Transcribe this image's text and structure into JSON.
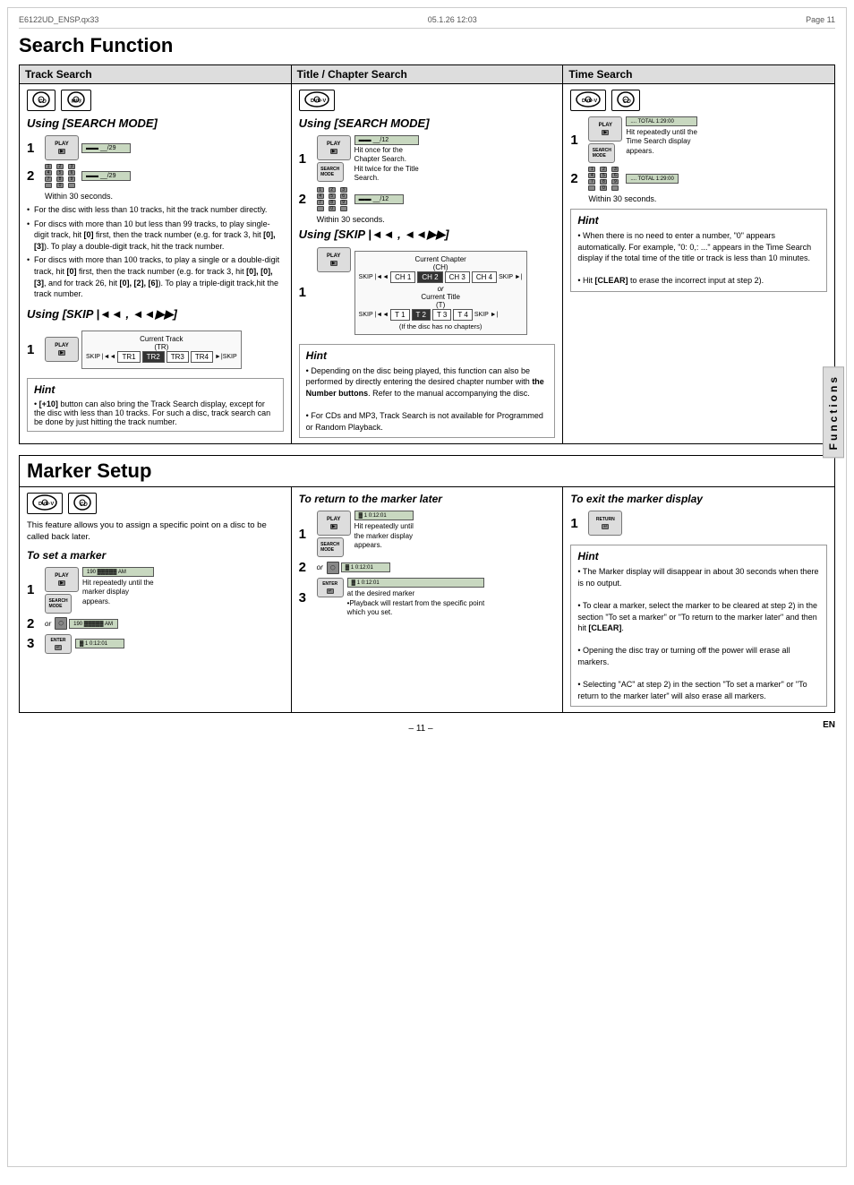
{
  "header": {
    "filename": "E6122UD_ENSP.qx33",
    "date": "05.1.26 12:03",
    "page_ref": "Page 11"
  },
  "main_title": "Search Function",
  "sections": {
    "track_search": {
      "title": "Track Search",
      "mode_icons": [
        "CD",
        "MP3"
      ],
      "using_search_mode_title": "Using [SEARCH MODE]",
      "steps": [
        {
          "num": "1",
          "screen": "__/29"
        },
        {
          "num": "2",
          "screen": "__/29"
        }
      ],
      "within_text": "Within 30 seconds.",
      "bullets": [
        "For the disc with less than 10 tracks, hit the track number directly.",
        "For discs with more than 10 but less than 99 tracks, to play single-digit track, hit [0] first, then the track number (e.g. for track 3, hit [0],[3]). To play a double-digit track, hit the track number.",
        "For discs with more than 100 tracks, to play a single or a double-digit track, hit [0] first, then the track number (e.g. for track 3, hit [0], [0],[3], and for track 26, hit [0], [2], [6]). To play a triple-digit track,hit the track number."
      ],
      "using_skip_title": "Using [SKIP |◄◄ , ►►|]",
      "skip_step": {
        "num": "1"
      },
      "skip_diagram": {
        "label": "Current Track (TR)",
        "tracks": [
          "TR1",
          "TR2",
          "TR3",
          "TR4"
        ],
        "current": "TR2",
        "skip_left": "SKIP |◄◄",
        "skip_right": "◄◄►► SKIP"
      },
      "hint_title": "Hint",
      "hint_bullets": [
        "• [+10] button can also bring the Track Search display, except for the disc with less than 10 tracks. For such a disc, track search can be done by just hitting the track number."
      ]
    },
    "title_chapter_search": {
      "title": "Title / Chapter Search",
      "mode_icons": [
        "DVD·V"
      ],
      "using_search_mode_title": "Using [SEARCH MODE]",
      "step1_text": "Hit once for the Chapter Search. Hit twice for the Title Search.",
      "steps": [
        {
          "num": "1",
          "screen": "__/12"
        },
        {
          "num": "2",
          "screen": "__/12"
        }
      ],
      "within_text": "Within 30 seconds.",
      "using_skip_title": "Using [SKIP |◄◄ , ►►|]",
      "skip_step": {
        "num": "1"
      },
      "chapter_diagram": {
        "current_ch_label": "Current Chapter (CH)",
        "ch_tracks": [
          "CH 1",
          "CH 2",
          "CH 3",
          "CH 4"
        ],
        "current_ch": "CH 2",
        "skip_left": "SKIP |◄◄",
        "skip_right": "SKIP ►|",
        "or_label": "or",
        "current_title_label": "Current Title (T)",
        "t_tracks": [
          "T 1",
          "T 2",
          "T 3",
          "T 4"
        ],
        "current_t": "T 2",
        "no_chapters_note": "(If the disc has no chapters)"
      },
      "hint_title": "Hint",
      "hint_bullets": [
        "• Depending on the disc being played, this function can also be performed by directly entering the desired chapter number with the Number buttons. Refer to the manual accompanying the disc.",
        "• For CDs and MP3, Track Search is not available for Programmed or Random Playback."
      ]
    },
    "time_search": {
      "title": "Time Search",
      "mode_icons": [
        "DVD·V",
        "CD"
      ],
      "steps": [
        {
          "num": "1",
          "screen": "....  TOTAL 1:29:00",
          "text": "Hit repeatedly until the Time Search display appears."
        },
        {
          "num": "2",
          "screen": "....  TOTAL 1:29:00"
        }
      ],
      "within_text": "Within 30 seconds.",
      "hint_title": "Hint",
      "hint_bullets": [
        "• When there is no need to enter a number, \"0\" appears automatically. For example, \"0: 0,: ...\" appears in the Time Search display if the total time of the title or track is less than 10 minutes.",
        "• Hit [CLEAR] to erase the incorrect input at step 2)."
      ]
    }
  },
  "marker_setup": {
    "title": "Marker Setup",
    "mode_icons": [
      "DVD·V",
      "CD"
    ],
    "intro": "This feature allows you to assign a specific point on a disc to be called back later.",
    "set_marker": {
      "title": "To set a marker",
      "steps": [
        {
          "num": "1",
          "screen": "190 0 0 0 0 AM",
          "text": "Hit repeatedly until the marker display appears."
        },
        {
          "num": "2",
          "screen": "190 0 0 0 0 AM",
          "or": true
        },
        {
          "num": "3",
          "screen": "1 0:12:01",
          "enter": true
        }
      ]
    },
    "return_to_marker": {
      "title": "To return to the marker later",
      "steps": [
        {
          "num": "1",
          "screen": "1 0:12:01",
          "text": "Hit repeatedly until the marker display appears."
        },
        {
          "num": "2",
          "screen": "1 0:12:01",
          "or": true
        },
        {
          "num": "3",
          "screen": "1 0:12:01",
          "enter": true,
          "note": "at the desired marker\n•Playback will restart from the specific point which you set."
        }
      ]
    },
    "exit_marker": {
      "title": "To exit the marker display",
      "steps": [
        {
          "num": "1",
          "return_btn": true
        }
      ],
      "hint_title": "Hint",
      "hint_bullets": [
        "• The Marker display will disappear in about 30 seconds when there is no output.",
        "• To clear a marker, select the marker to be cleared at step 2) in the section \"To set a marker\" or \"To return to the marker later\" and then hit [CLEAR].",
        "• Opening the disc tray or turning off the power will erase all markers.",
        "• Selecting \"AC\" at step 2) in the section \"To set a marker\" or \"To return to the marker later\" will also erase all markers."
      ]
    }
  },
  "sidebar_label": "Functions",
  "page_number": "– 11 –",
  "lang_label": "EN"
}
